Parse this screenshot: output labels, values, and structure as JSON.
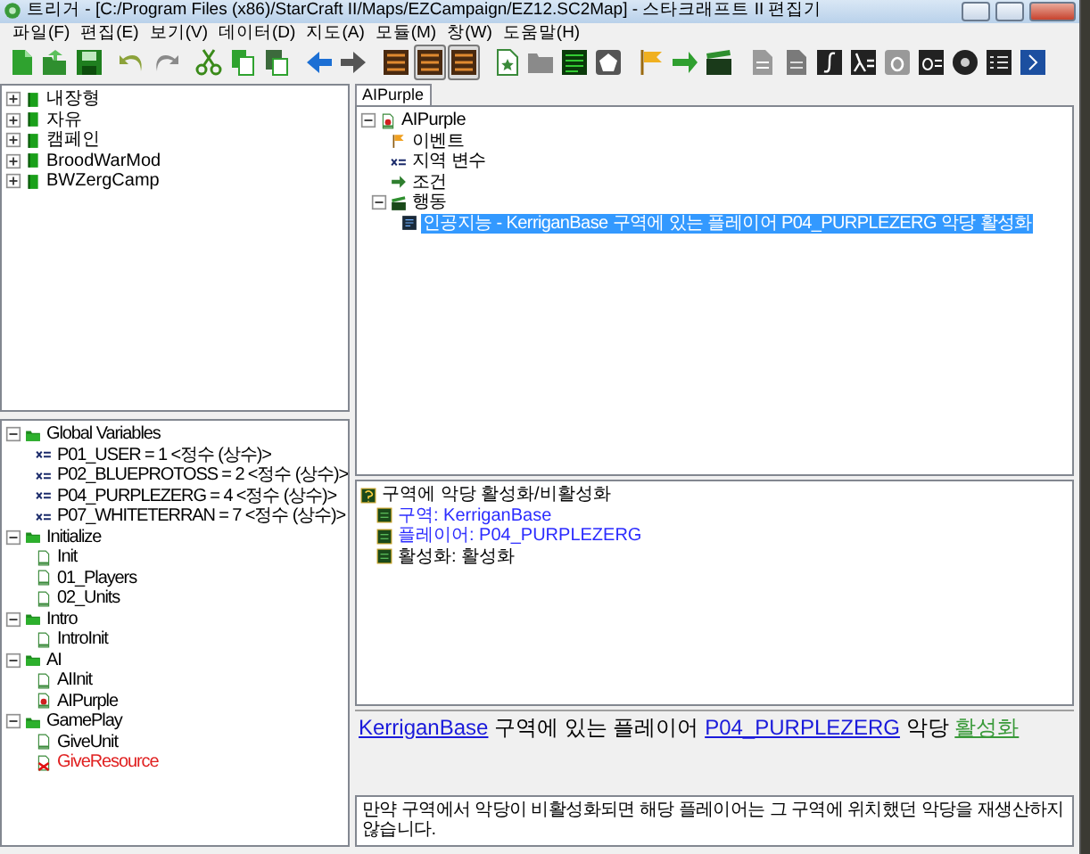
{
  "window": {
    "title": "트리거 - [C:/Program Files (x86)/StarCraft II/Maps/EZCampaign/EZ12.SC2Map] - 스타크래프트 II 편집기"
  },
  "menu": [
    "파일(F)",
    "편집(E)",
    "보기(V)",
    "데이터(D)",
    "지도(A)",
    "모듈(M)",
    "창(W)",
    "도움말(H)"
  ],
  "toolbar": [
    {
      "pressed": false
    },
    {
      "pressed": false
    },
    {
      "pressed": false
    },
    {
      "pressed": false
    },
    {
      "pressed": false
    },
    {
      "pressed": false
    },
    {
      "pressed": false
    },
    {
      "pressed": false
    },
    {
      "pressed": false
    },
    {
      "pressed": false
    },
    {
      "pressed": false
    },
    {
      "pressed": true
    },
    {
      "pressed": true
    },
    {
      "pressed": false
    },
    {
      "pressed": false
    },
    {
      "pressed": false
    },
    {
      "pressed": false
    },
    {
      "pressed": false
    },
    {
      "pressed": false
    },
    {
      "pressed": false
    },
    {
      "pressed": false
    },
    {
      "pressed": false
    },
    {
      "pressed": false
    },
    {
      "pressed": false
    },
    {
      "pressed": false
    },
    {
      "pressed": false
    },
    {
      "pressed": false
    },
    {
      "pressed": false
    },
    {
      "pressed": false
    }
  ],
  "library_tree": [
    {
      "label": "내장형",
      "expanded": false
    },
    {
      "label": "자유",
      "expanded": false
    },
    {
      "label": "캠페인",
      "expanded": false
    },
    {
      "label": "BroodWarMod",
      "expanded": false
    },
    {
      "label": "BWZergCamp",
      "expanded": false
    }
  ],
  "trigger_tree": [
    {
      "label": "Global Variables",
      "kind": "folder",
      "expanded": true,
      "children": [
        {
          "label": "P01_USER = 1 <정수 (상수)>",
          "kind": "variable"
        },
        {
          "label": "P02_BLUEPROTOSS = 2 <정수 (상수)>",
          "kind": "variable"
        },
        {
          "label": "P04_PURPLEZERG = 4 <정수 (상수)>",
          "kind": "variable"
        },
        {
          "label": "P07_WHITETERRAN = 7 <정수 (상수)>",
          "kind": "variable"
        }
      ]
    },
    {
      "label": "Initialize",
      "kind": "folder",
      "expanded": true,
      "children": [
        {
          "label": "Init",
          "kind": "trigger",
          "open": false,
          "error": false
        },
        {
          "label": "01_Players",
          "kind": "trigger",
          "open": false,
          "error": false
        },
        {
          "label": "02_Units",
          "kind": "trigger",
          "open": false,
          "error": false
        }
      ]
    },
    {
      "label": "Intro",
      "kind": "folder",
      "expanded": true,
      "children": [
        {
          "label": "IntroInit",
          "kind": "trigger",
          "open": false,
          "error": false
        }
      ]
    },
    {
      "label": "AI",
      "kind": "folder",
      "expanded": true,
      "children": [
        {
          "label": "AIInit",
          "kind": "trigger",
          "open": false,
          "error": false
        },
        {
          "label": "AIPurple",
          "kind": "trigger",
          "open": true,
          "error": false
        }
      ]
    },
    {
      "label": "GamePlay",
      "kind": "folder",
      "expanded": true,
      "children": [
        {
          "label": "GiveUnit",
          "kind": "trigger",
          "open": false,
          "error": false
        },
        {
          "label": "GiveResource",
          "kind": "trigger",
          "open": false,
          "error": true
        }
      ]
    }
  ],
  "editor_tab": {
    "label": "AIPurple",
    "selected": true
  },
  "element_tree": [
    {
      "label": "AIPurple",
      "kind": "trigger",
      "open": true,
      "error": false,
      "selected": false,
      "expanded": true,
      "children": [
        {
          "label": "이벤트",
          "kind": "event",
          "selected": false
        },
        {
          "label": "지역 변수",
          "kind": "variable",
          "selected": false
        },
        {
          "label": "조건",
          "kind": "condition",
          "selected": false
        },
        {
          "label": "행동",
          "kind": "actions",
          "selected": false,
          "expanded": true,
          "children": [
            {
              "label": "인공지능 - KerriganBase 구역에 있는 플레이어 P04_PURPLEZERG 악당 활성화",
              "kind": "action",
              "selected": true
            }
          ]
        }
      ]
    }
  ],
  "parameters": {
    "label": "구역에 악당 활성화/비활성화",
    "children": [
      {
        "label": "구역: KerriganBase",
        "linked": true
      },
      {
        "label": "플레이어: P04_PURPLEZERG",
        "linked": true
      },
      {
        "label": "활성화: 활성화",
        "linked": false
      }
    ]
  },
  "description": [
    {
      "text": "KerriganBase",
      "kind": "link"
    },
    {
      "text": "구역에 있는 플레이어",
      "kind": "text"
    },
    {
      "text": "P04_PURPLEZERG",
      "kind": "link"
    },
    {
      "text": "악당",
      "kind": "text"
    },
    {
      "text": "활성화",
      "kind": "preset"
    }
  ],
  "comment": "만약 구역에서 악당이 비활성화되면 해당 플레이어는 그 구역에 위치했던 악당을 재생산하지 않습니다."
}
